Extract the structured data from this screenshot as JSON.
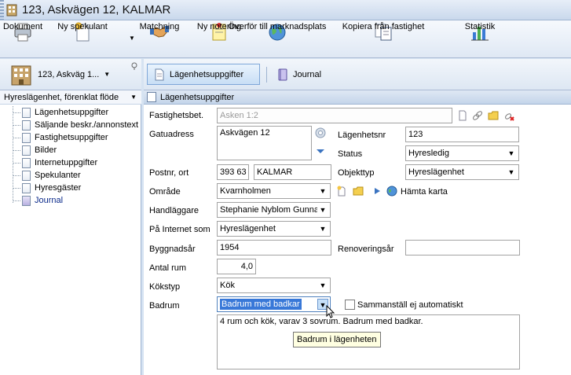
{
  "window": {
    "title": "123, Askvägen 12, KALMAR"
  },
  "toolbar": {
    "items": [
      {
        "label": "Dokument",
        "icon": "printer-icon"
      },
      {
        "label": "Ny spekulant",
        "icon": "new-document-icon"
      },
      {
        "label": "Matchning",
        "icon": "handshake-icon"
      },
      {
        "label": "Ny notering",
        "icon": "note-icon"
      },
      {
        "label": "Överför till marknadsplats",
        "icon": "globe-icon"
      },
      {
        "label": "Kopiera från fastighet",
        "icon": "copy-icon"
      },
      {
        "label": "Statistik",
        "icon": "bar-chart-icon"
      }
    ]
  },
  "left": {
    "property_name": "123, Askväg 1...",
    "flow": "Hyreslägenhet, förenklat flöde",
    "tree": [
      "Lägenhetsuppgifter",
      "Säljande beskr./annonstext",
      "Fastighetsuppgifter",
      "Bilder",
      "Internetuppgifter",
      "Spekulanter",
      "Hyresgäster",
      "Journal"
    ]
  },
  "tabs": {
    "active": "Lägenhetsuppgifter",
    "journal": "Journal"
  },
  "section": {
    "title": "Lägenhetsuppgifter"
  },
  "form": {
    "fastighetsbet_label": "Fastighetsbet.",
    "fastighetsbet_value": "Asken 1:2",
    "gatuadress_label": "Gatuadress",
    "gatuadress_value": "Askvägen 12",
    "lagenhetsnr_label": "Lägenhetsnr",
    "lagenhetsnr_value": "123",
    "status_label": "Status",
    "status_value": "Hyresledig",
    "postnr_label": "Postnr, ort",
    "postnr_value": "393 63",
    "ort_value": "KALMAR",
    "objekttyp_label": "Objekttyp",
    "objekttyp_value": "Hyreslägenhet",
    "omrade_label": "Område",
    "omrade_value": "Kvarnholmen",
    "hamta_karta": "Hämta karta",
    "handlaggare_label": "Handläggare",
    "handlaggare_value": "Stephanie Nyblom Gunna",
    "internet_label": "På Internet som",
    "internet_value": "Hyreslägenhet",
    "byggnadsar_label": "Byggnadsår",
    "byggnadsar_value": "1954",
    "renoveringsar_label": "Renoveringsår",
    "renoveringsar_value": "",
    "antal_rum_label": "Antal rum",
    "antal_rum_value": "4,0",
    "kokstyp_label": "Kökstyp",
    "kokstyp_value": "Kök",
    "badrum_label": "Badrum",
    "badrum_value": "Badrum med badkar",
    "sammanstall_label": "Sammanställ ej automatiskt",
    "summary_text": "4 rum och kök, varav 3 sovrum. Badrum med badkar.",
    "tooltip": "Badrum i lägenheten"
  }
}
